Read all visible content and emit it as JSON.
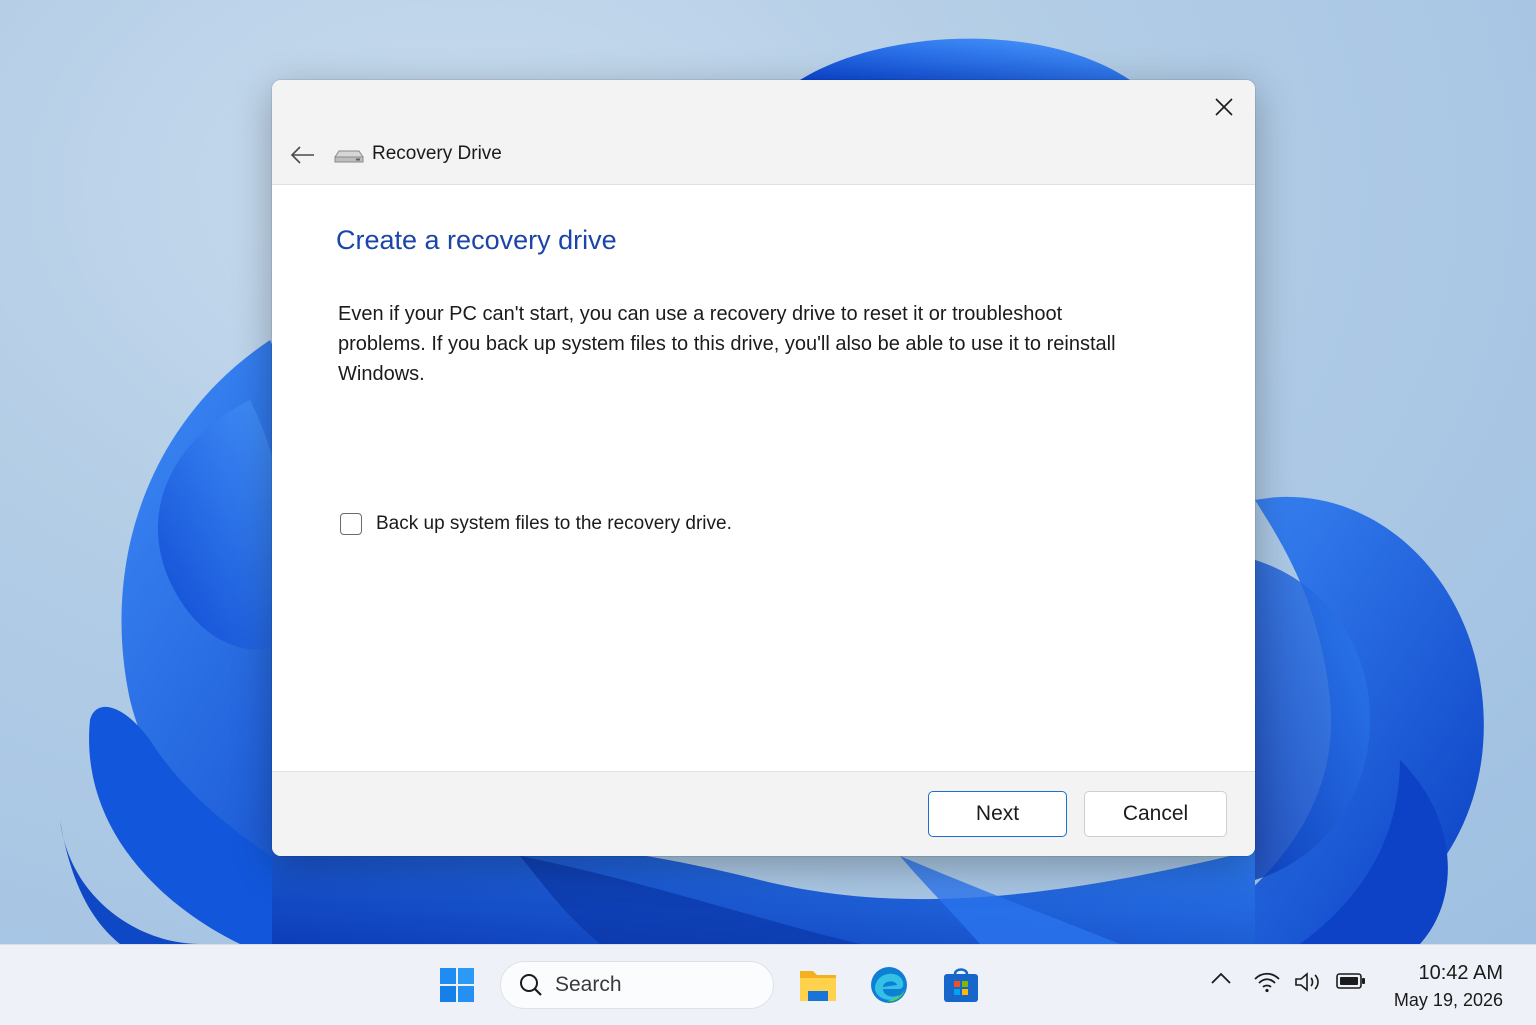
{
  "dialog": {
    "title": "Recovery Drive",
    "heading": "Create a recovery drive",
    "description": "Even if your PC can't start, you can use a recovery drive to reset it or troubleshoot problems. If you back up system files to this drive, you'll also be able to use it to reinstall Windows.",
    "checkbox_label": "Back up system files to the recovery drive.",
    "checkbox_checked": false,
    "next_label": "Next",
    "cancel_label": "Cancel",
    "icons": {
      "back": "back-arrow-icon",
      "app": "drive-icon",
      "close": "close-icon"
    }
  },
  "taskbar": {
    "search_placeholder": "Search",
    "pinned": [
      "start-icon",
      "file-explorer-icon",
      "edge-icon",
      "microsoft-store-icon"
    ],
    "tray": [
      "chevron-up-icon",
      "wifi-icon",
      "volume-icon",
      "battery-icon"
    ],
    "time": "10:42 AM",
    "date": "May 19, 2026"
  },
  "colors": {
    "accent": "#1a6fd0",
    "heading": "#1b45a8",
    "wallpaper_bloom": "#1565e6"
  }
}
